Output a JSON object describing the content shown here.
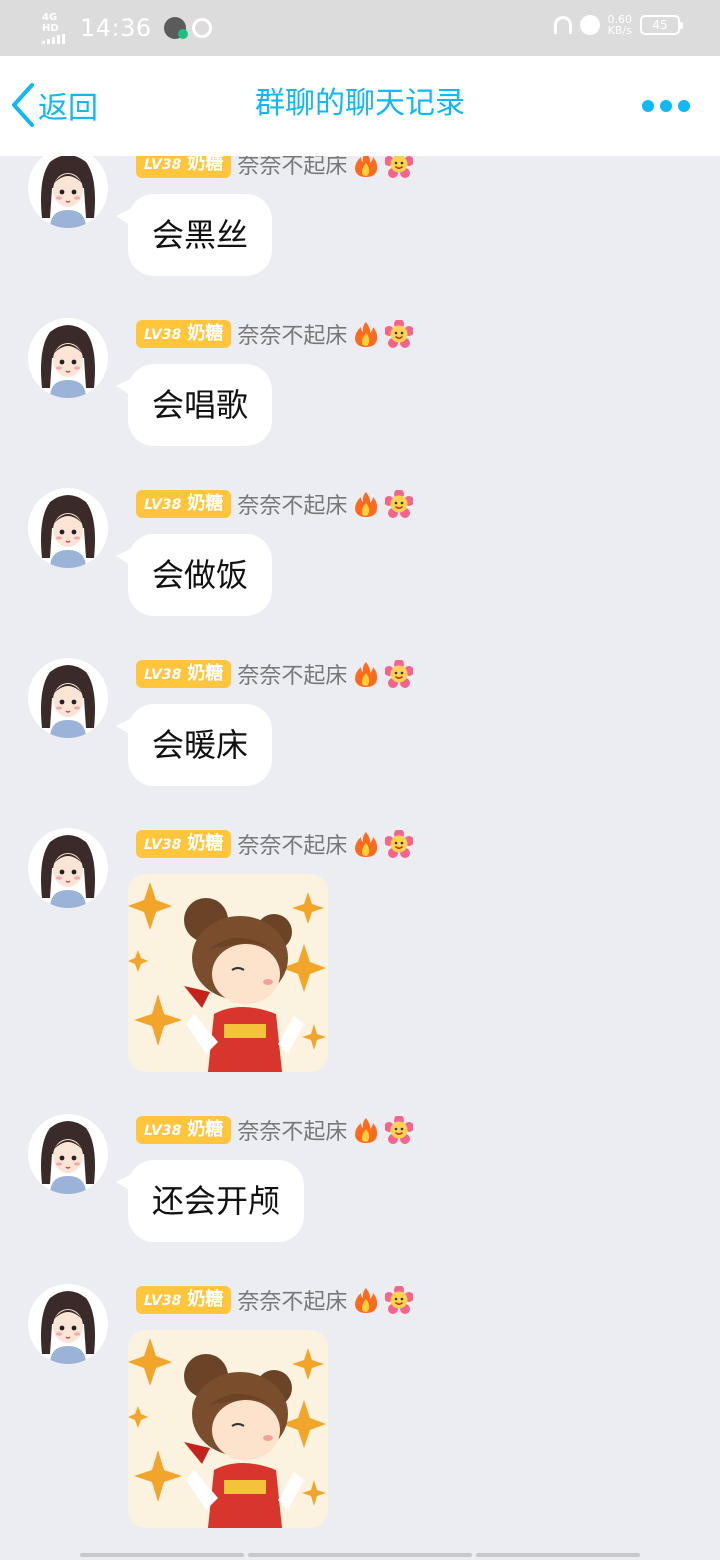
{
  "status_bar": {
    "network": "4G HD",
    "time": "14:36",
    "speed_value": "0.60",
    "speed_unit": "KB/s",
    "battery": "45"
  },
  "header": {
    "back_label": "返回",
    "title": "群聊的聊天记录"
  },
  "colors": {
    "accent": "#12b7f5",
    "badge": "#ffc53d",
    "background": "#ebedf2"
  },
  "icons": {
    "back": "chevron-left-icon",
    "more": "more-dots-icon",
    "fire": "fire-icon",
    "flower": "flower-face-icon"
  },
  "sender": {
    "level": "LV38",
    "title": "奶糖",
    "name": "奈奈不起床"
  },
  "messages": [
    {
      "type": "text",
      "text": "会黑丝"
    },
    {
      "type": "text",
      "text": "会唱歌"
    },
    {
      "type": "text",
      "text": "会做饭"
    },
    {
      "type": "text",
      "text": "会暖床"
    },
    {
      "type": "sticker"
    },
    {
      "type": "text",
      "text": "还会开颅"
    },
    {
      "type": "sticker"
    }
  ]
}
